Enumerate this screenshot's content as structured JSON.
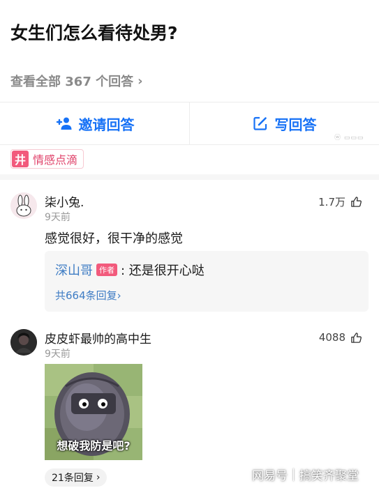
{
  "question": {
    "title": "女生们怎么看待处男?",
    "view_all": "查看全部 367 个回答",
    "view_all_icon": "chevron-right-icon"
  },
  "actions": {
    "invite_label": "邀请回答",
    "write_label": "写回答",
    "accent": "#1772f6"
  },
  "tag": {
    "symbol": "井",
    "label": "情感点滴",
    "color": "#f25a7c"
  },
  "comments": [
    {
      "name": "柒小兔.",
      "time": "9天前",
      "likes": "1.7万",
      "text": "感觉很好，很干净的感觉",
      "reply": {
        "author": "深山哥",
        "badge": "作者",
        "text": ": 还是很开心哒",
        "count": "共664条回复›"
      }
    },
    {
      "name": "皮皮虾最帅的高中生",
      "time": "9天前",
      "likes": "4088",
      "meme_caption": "想破我防是吧?",
      "reply_count": "21条回复",
      "reply_chevron": "›"
    }
  ],
  "watermark": {
    "source": "网易号",
    "account": "搞笑齐聚堂",
    "top_mark": "ⓦ ▭▭▭"
  }
}
